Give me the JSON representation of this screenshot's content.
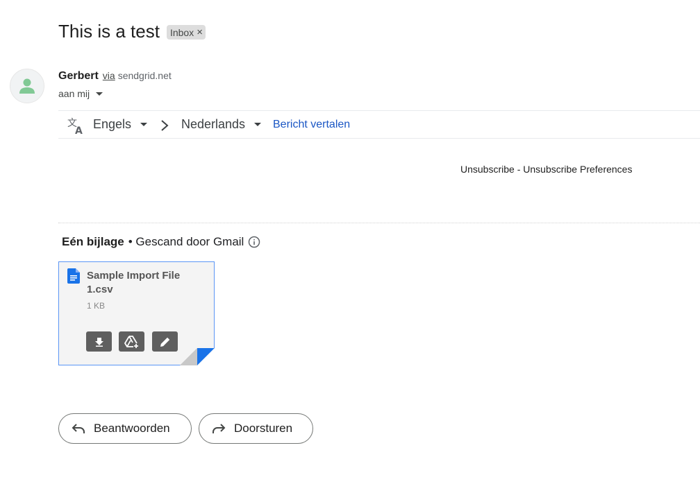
{
  "subject": "This is a test",
  "label": {
    "text": "Inbox",
    "close_glyph": "×"
  },
  "sender": {
    "name": "Gerbert",
    "via": "via",
    "domain": "sendgrid.net",
    "to": "aan mij",
    "avatar_icon": "person-icon"
  },
  "translate": {
    "icon": "translate-icon",
    "from_lang": "Engels",
    "to_lang": "Nederlands",
    "action": "Bericht vertalen"
  },
  "body": {
    "unsubscribe": "Unsubscribe",
    "separator": " - ",
    "unsubscribe_prefs": "Unsubscribe Preferences"
  },
  "attachments": {
    "count_label": "Eén bijlage",
    "scanned_label": "• Gescand door Gmail",
    "items": [
      {
        "name": "Sample Import File 1.csv",
        "size": "1 KB",
        "file_icon": "google-docs-icon"
      }
    ],
    "actions": [
      "download-icon",
      "add-to-drive-icon",
      "edit-icon"
    ]
  },
  "actions": {
    "reply": "Beantwoorden",
    "forward": "Doorsturen"
  },
  "colors": {
    "link": "#1a56c4",
    "avatar": "#81c995",
    "card_border": "#5a95f5",
    "doc_blue": "#1a73e8"
  }
}
